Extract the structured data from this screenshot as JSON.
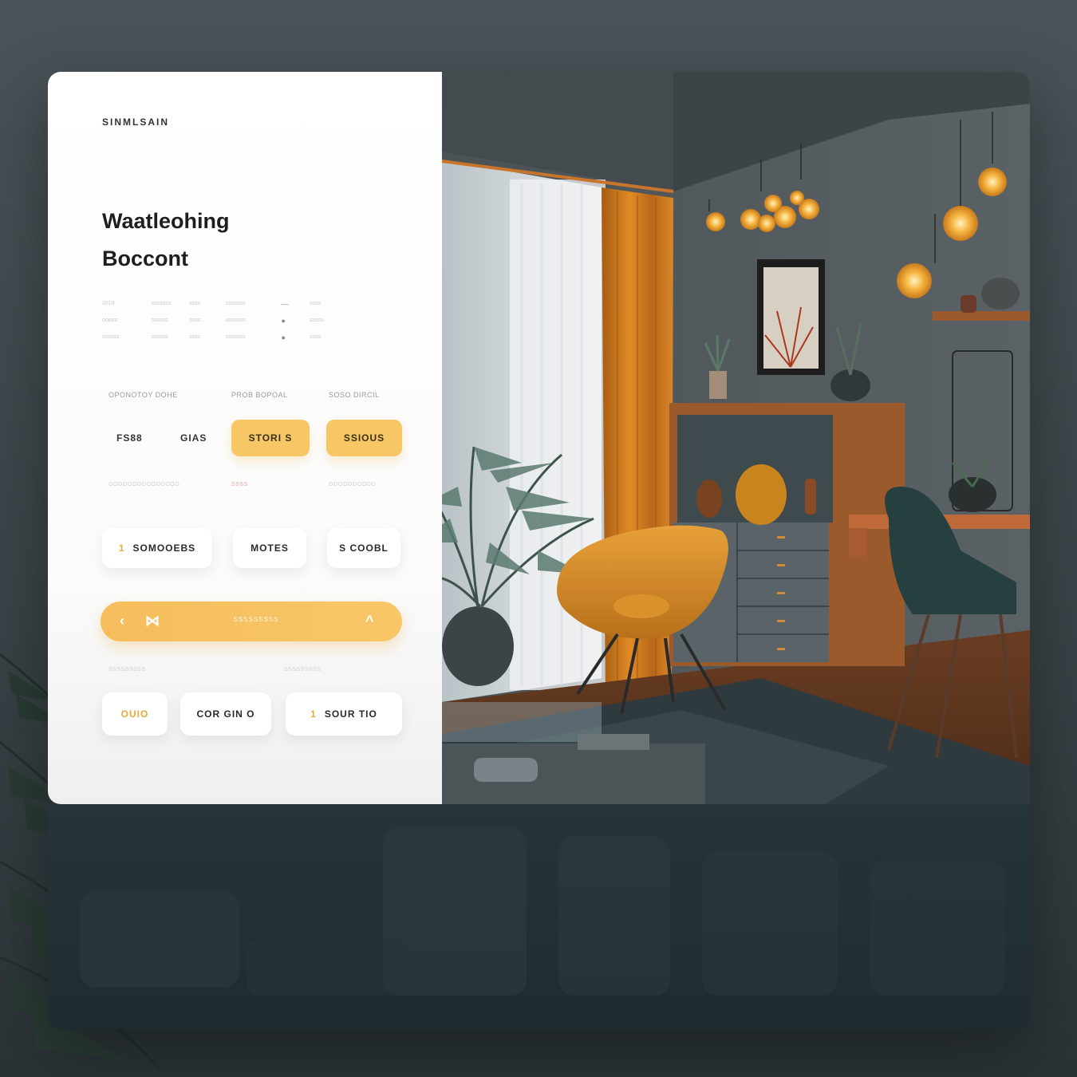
{
  "panel": {
    "brand": "SINMLSAIN",
    "title_line1": "Waatleohing",
    "title_line2": "Boccont",
    "meta_rows": [
      [
        "2019",
        "sssssss",
        "ssss",
        "sssssss",
        "—",
        "ssss"
      ],
      [
        "ooooo",
        "ssssss",
        "ssss",
        "sssssss",
        "●",
        "sssss"
      ],
      [
        "ssssss",
        "ssssss",
        "ssss",
        "sssssss",
        "●",
        "ssss"
      ]
    ],
    "section1": {
      "labels": [
        "OPONOTOY DOHE",
        "PROB BOPOAL",
        "SOSO DIRCIL"
      ],
      "text_buttons": [
        "FS88",
        "GIAS"
      ],
      "chips": [
        "STORI S",
        "SSIOUS"
      ],
      "sub_labels": [
        "OOOOOOOOOOOOOOO",
        "SSSS",
        "OOOOOOOOOO"
      ]
    },
    "section2": {
      "items": [
        {
          "icon": "1",
          "label": "SOMOOEBS"
        },
        {
          "icon": "",
          "label": "MOTES"
        },
        {
          "icon": "",
          "label": "S COOBL"
        }
      ]
    },
    "cta": {
      "left_icon_1": "‹",
      "left_icon_2": "⋈",
      "label": "SSSSSSSSS",
      "right_icon": "^"
    },
    "section3": {
      "labels": [
        "SSSSSSSSS",
        "SSSSSSSSS"
      ],
      "buttons": [
        {
          "icon": "",
          "label": "OUIO",
          "accent": true
        },
        {
          "icon": "",
          "label": "COR GIN O",
          "accent": false
        },
        {
          "icon": "1",
          "label": "SOUR TIO",
          "accent": false
        }
      ]
    }
  },
  "colors": {
    "accent": "#f7c766",
    "background": "#3a4347",
    "panel": "#ffffff",
    "chair": "#d58c22",
    "curtain": "#d2801f"
  },
  "icons": [
    "back-chevron-icon",
    "bowtie-icon",
    "up-chevron-icon"
  ]
}
